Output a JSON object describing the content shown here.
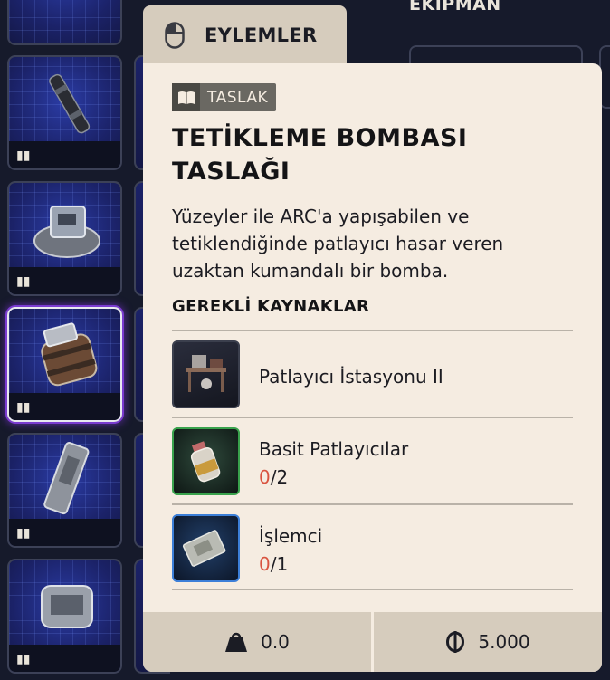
{
  "header": {
    "tab_label": "EYLEMLER",
    "section_label": "EKİPMAN"
  },
  "item": {
    "badge": "TASLAK",
    "title": "TETİKLEME BOMBASI TASLAĞI",
    "description": "Yüzeyler ile ARC'a yapışabilen ve tetiklendiğinde patlayıcı hasar veren uzaktan kumandalı bir bomba."
  },
  "requirements": {
    "title": "GEREKLİ KAYNAKLAR",
    "items": [
      {
        "name": "Patlayıcı İstasyonu II",
        "icon": "workbench-icon"
      },
      {
        "name": "Basit Patlayıcılar",
        "have": "0",
        "need": "/2",
        "icon": "explosive-bottle-icon"
      },
      {
        "name": "İşlemci",
        "have": "0",
        "need": "/1",
        "icon": "processor-icon"
      }
    ]
  },
  "footer": {
    "weight": "0.0",
    "price": "5.000"
  },
  "colors": {
    "panel_bg": "#f5ece1",
    "tab_bg": "#d6ccbd",
    "missing_count": "#d9533f",
    "bg": "#161a2b"
  }
}
